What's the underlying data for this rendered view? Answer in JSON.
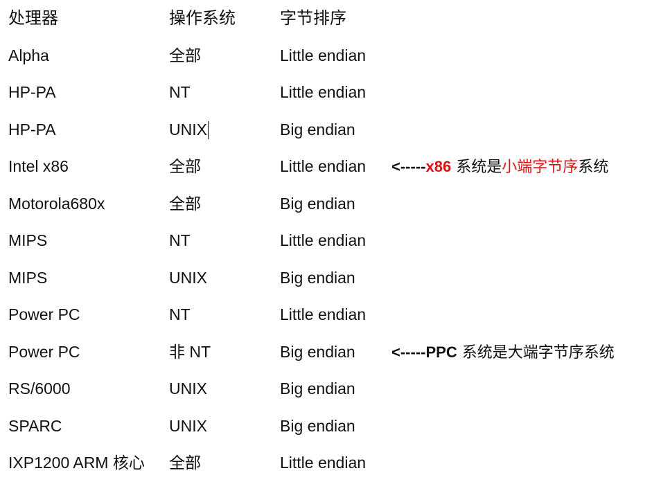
{
  "header": {
    "col1": "处理器",
    "col2": "操作系统",
    "col3": "字节排序"
  },
  "rows": [
    {
      "cpu": "Alpha",
      "os": "全部",
      "order": "Little endian"
    },
    {
      "cpu": "HP-PA",
      "os": "NT",
      "order": "Little endian"
    },
    {
      "cpu": "HP-PA",
      "os": "UNIX",
      "order": "Big endian"
    },
    {
      "cpu": "Intel x86",
      "os": "全部",
      "order": "Little endian"
    },
    {
      "cpu": "Motorola680x",
      "os": "全部",
      "order": "Big endian"
    },
    {
      "cpu": "MIPS",
      "os": "NT",
      "order": "Little endian"
    },
    {
      "cpu": "MIPS",
      "os": "UNIX",
      "order": "Big endian"
    },
    {
      "cpu": "Power PC",
      "os": "NT",
      "order": "Little endian"
    },
    {
      "cpu": "Power PC",
      "os": "非 NT",
      "order": "Big endian"
    },
    {
      "cpu": "RS/6000",
      "os": "UNIX",
      "order": "Big endian"
    },
    {
      "cpu": "SPARC",
      "os": "UNIX",
      "order": "Big endian"
    },
    {
      "cpu": "IXP1200 ARM 核心",
      "os": "全部",
      "order": "Little endian"
    }
  ],
  "notes": {
    "x86": {
      "arrow": "<-----",
      "tag": "x86",
      "text_a": " 系统是",
      "text_red": "小端字节序",
      "text_b": "系统"
    },
    "ppc": {
      "arrow": "<-----",
      "tag": "PPC",
      "text": " 系统是大端字节序系统"
    }
  },
  "colors": {
    "text": "#111111",
    "highlight": "#e01010"
  }
}
